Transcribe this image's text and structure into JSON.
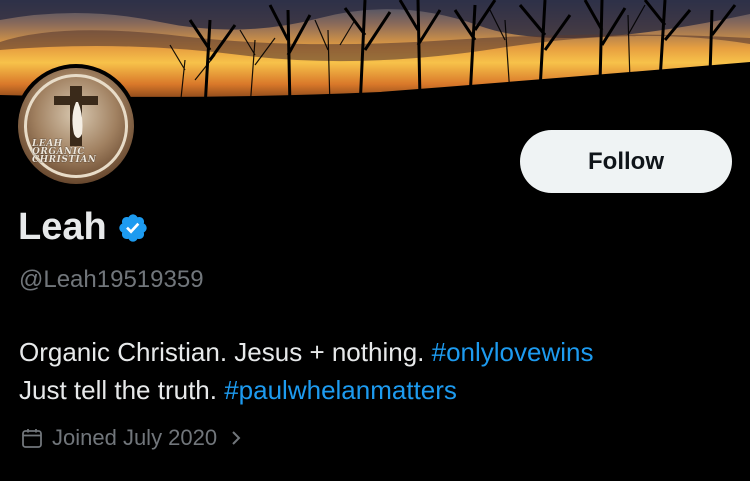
{
  "profile": {
    "display_name": "Leah",
    "handle": "@Leah19519359",
    "verified_icon": "verified-badge-icon",
    "avatar_logo_lines": [
      "LEAH",
      "ORGANIC",
      "CHRISTIAN"
    ],
    "bio_line1_text": "Organic Christian. Jesus + nothing.",
    "bio_line1_hashtag": "#onlylovewins",
    "bio_line2_text": "Just tell the truth.",
    "bio_line2_hashtag": "#paulwhelanmatters",
    "joined": "Joined July 2020"
  },
  "actions": {
    "follow_label": "Follow"
  },
  "icons": {
    "calendar": "calendar-icon",
    "chevron": "chevron-right-icon"
  },
  "colors": {
    "background": "#000000",
    "link": "#1d9bf0",
    "secondary_text": "#71767b",
    "follow_button_bg": "#eff3f4",
    "verified": "#1d9bf0"
  }
}
